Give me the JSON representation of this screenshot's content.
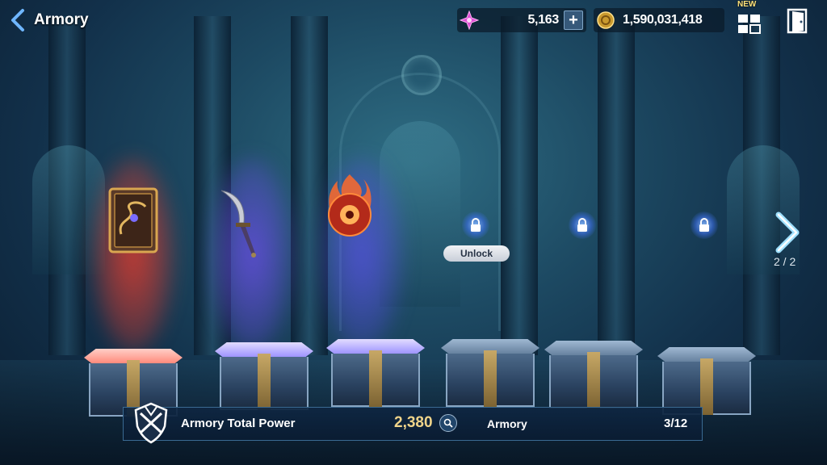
{
  "header": {
    "title": "Armory",
    "gem_amount": "5,163",
    "gold_amount": "1,590,031,418",
    "menu_new_badge": "NEW"
  },
  "slots": [
    {
      "name": "Dragon Tome",
      "state": "equipped",
      "beam_color": "#ff3b2b"
    },
    {
      "name": "Curved Dagger",
      "state": "equipped",
      "beam_color": "#6d4bff"
    },
    {
      "name": "Flame Orb",
      "state": "equipped",
      "beam_color": "#5c46ff"
    },
    {
      "name": "Locked Slot",
      "state": "unlockable"
    },
    {
      "name": "Locked Slot",
      "state": "locked"
    },
    {
      "name": "Locked Slot",
      "state": "locked"
    }
  ],
  "unlock_label": "Unlock",
  "pagination": "2 / 2",
  "footer": {
    "total_power_label": "Armory Total Power",
    "total_power_value": "2,380",
    "armory_label": "Armory",
    "armory_count": "3/12"
  },
  "colors": {
    "accent_gold": "#f0d48a",
    "panel_border": "#3a6a92"
  }
}
